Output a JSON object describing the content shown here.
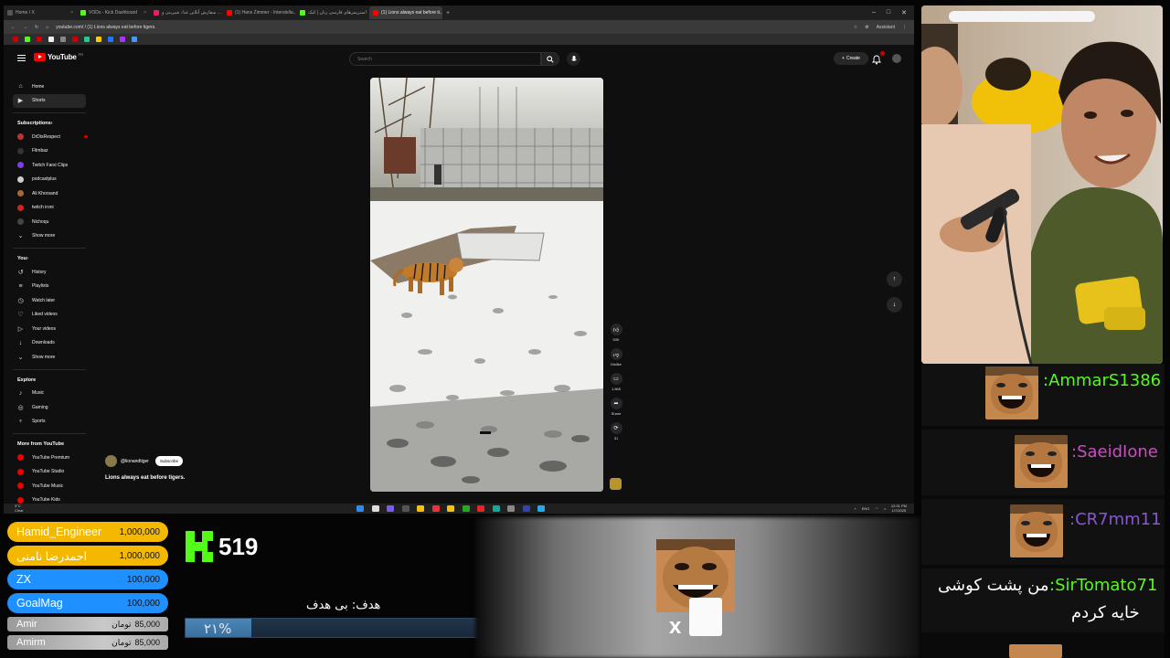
{
  "browser": {
    "tabs": [
      {
        "label": "Home / X",
        "color": "#555"
      },
      {
        "label": "VODs - Kick Dashboard",
        "color": "#53fc18"
      },
      {
        "label": "سفارش آنلاین غذا، شیرینی و ...",
        "color": "#e91e63"
      },
      {
        "label": "(1) Hans Zimmer - Interstella...",
        "color": "#ff0000"
      },
      {
        "label": "استریمرهای فارسی زبان | کیک",
        "color": "#53fc18"
      },
      {
        "label": "(1) Lions always eat before ti...",
        "color": "#ff0000"
      }
    ],
    "new_tab": "+",
    "url": "youtube.com/ / (1) Lions always eat before tigers.",
    "assistant": "Assistant"
  },
  "youtube": {
    "logo_text": "YouTube",
    "country": "FR",
    "search_placeholder": "Search",
    "create_label": "Create",
    "notif_badge": "9+",
    "sidebar_top": [
      {
        "label": "Home",
        "icon": "home-icon",
        "glyph": "⌂"
      },
      {
        "label": "Shorts",
        "icon": "shorts-icon",
        "glyph": "▶"
      }
    ],
    "subscriptions_header": "Subscriptions",
    "subscriptions": [
      {
        "label": "DrDisRespect",
        "color": "#b33"
      },
      {
        "label": "Filmbaz",
        "color": "#333"
      },
      {
        "label": "Twitch Farsi Clips",
        "color": "#7b3fe4"
      },
      {
        "label": "podcastplus",
        "color": "#ccc"
      },
      {
        "label": "Ali Khorsand",
        "color": "#a63"
      },
      {
        "label": "twitch ironi",
        "color": "#c22"
      },
      {
        "label": "Nichoqu",
        "color": "#444"
      }
    ],
    "show_more_1": "Show more",
    "you_header": "You",
    "you_items": [
      {
        "label": "History",
        "icon": "history-icon",
        "glyph": "↺"
      },
      {
        "label": "Playlists",
        "icon": "playlists-icon",
        "glyph": "≡"
      },
      {
        "label": "Watch later",
        "icon": "watch-later-icon",
        "glyph": "◷"
      },
      {
        "label": "Liked videos",
        "icon": "like-icon",
        "glyph": "♡"
      },
      {
        "label": "Your videos",
        "icon": "your-videos-icon",
        "glyph": "▷"
      },
      {
        "label": "Downloads",
        "icon": "download-icon",
        "glyph": "↓"
      },
      {
        "label": "Show more",
        "icon": "chevron-down-icon",
        "glyph": "⌄"
      }
    ],
    "explore_header": "Explore",
    "explore_items": [
      {
        "label": "Music",
        "icon": "music-icon",
        "glyph": "♪"
      },
      {
        "label": "Gaming",
        "icon": "gaming-icon",
        "glyph": "◎"
      },
      {
        "label": "Sports",
        "icon": "sports-icon",
        "glyph": "♆"
      }
    ],
    "more_header": "More from YouTube",
    "more_items": [
      {
        "label": "YouTube Premium"
      },
      {
        "label": "YouTube Studio"
      },
      {
        "label": "YouTube Music"
      },
      {
        "label": "YouTube Kids"
      }
    ],
    "channel": "@lionandtiger",
    "subscribe": "Subscribe",
    "title": "Lions always eat before tigers.",
    "likes": "53K",
    "dislike": "Dislike",
    "comments": "1,665",
    "share": "Share",
    "remix": "31"
  },
  "taskbar": {
    "weather_temp": "3°C",
    "weather_text": "Clear",
    "lang": "ENG",
    "time": "12:31 PM",
    "date": "1/7/2025"
  },
  "chat": [
    {
      "user": "AmmarS1386",
      "color": "#53fc18"
    },
    {
      "user": "SaeidIone",
      "color": "#c94fbf"
    },
    {
      "user": "CR7mm11",
      "color": "#8a55d6"
    },
    {
      "user": "SirTomato71",
      "color": "#53fc18",
      "text": "من پشت کوشی",
      "text2": "خایه کردم"
    }
  ],
  "donations": [
    {
      "name": "Hamid_Engineer",
      "amount": "1,000,000",
      "color": "#f5b800"
    },
    {
      "name": "احمدرضا نامنی",
      "amount": "1,000,000",
      "color": "#f5b800"
    },
    {
      "name": "ZX",
      "amount": "100,000",
      "color": "#1e90ff"
    },
    {
      "name": "GoalMag",
      "amount": "100,000",
      "color": "#1e90ff"
    },
    {
      "name": "Amir",
      "amount": "85,000",
      "currency": "تومان"
    },
    {
      "name": "Amirm",
      "amount": "85,000",
      "currency": "تومان"
    }
  ],
  "kick": {
    "viewers": "519"
  },
  "goal": {
    "label": "هدف: بی هدف",
    "percent_text": "۲۱%",
    "percent": 21
  },
  "alert": {
    "x": "x"
  }
}
